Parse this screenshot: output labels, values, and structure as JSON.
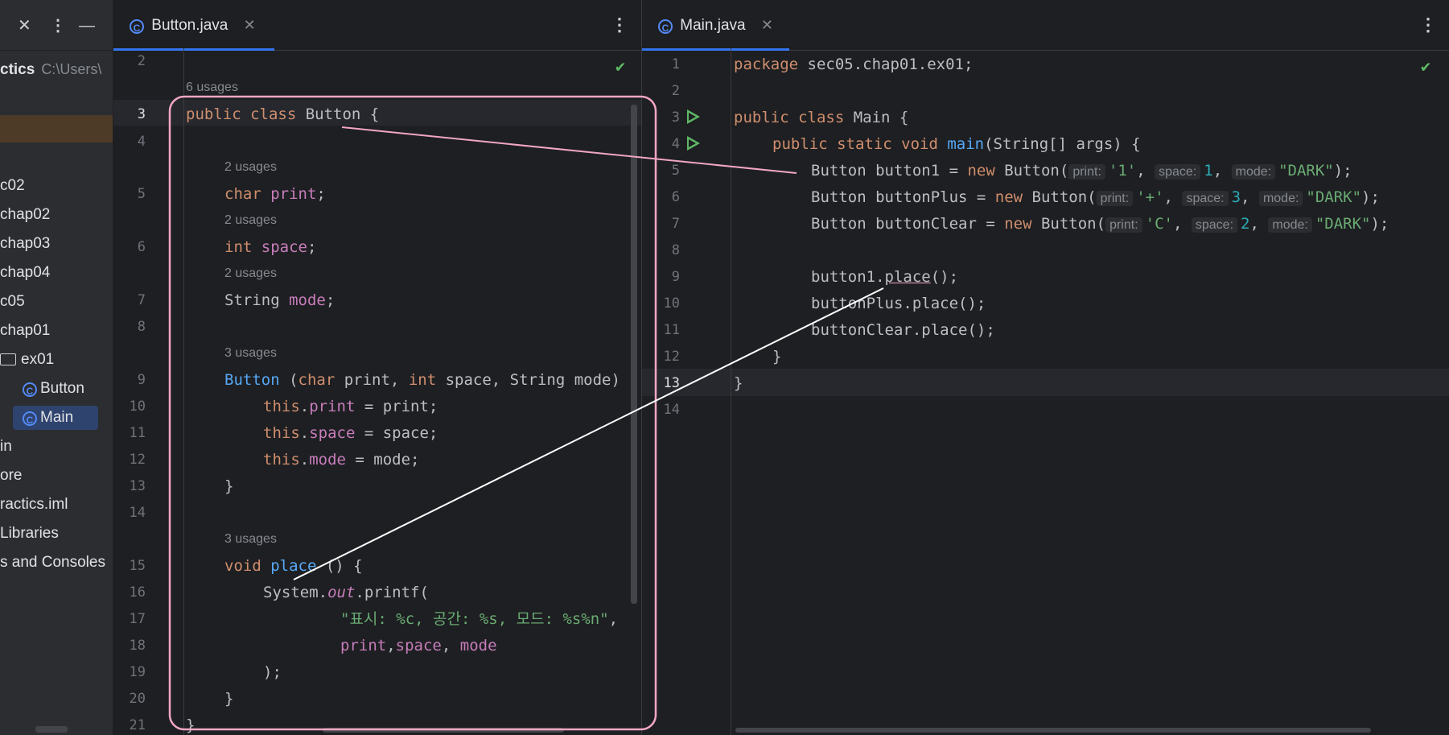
{
  "project": {
    "title": "ctics",
    "path": "C:\\Users\\",
    "tree": [
      "c02",
      "chap02",
      "chap03",
      "chap04",
      "c05",
      "chap01",
      "ex01",
      "Button",
      "Main",
      "in",
      "ore",
      "ractics.iml",
      "Libraries",
      "s and Consoles"
    ]
  },
  "tabs": {
    "left": "Button.java",
    "right": "Main.java"
  },
  "left_editor": {
    "line_numbers": [
      "2",
      "3",
      "4",
      "5",
      "6",
      "7",
      "8",
      "9",
      "10",
      "11",
      "12",
      "13",
      "14",
      "15",
      "16",
      "17",
      "18",
      "19",
      "20",
      "21"
    ],
    "usages": [
      "6 usages",
      "2 usages",
      "2 usages",
      "2 usages",
      "3 usages",
      "3 usages"
    ],
    "code": {
      "l3_kw": "public class ",
      "l3_name": "Button {",
      "l5_kw": "char ",
      "l5_f": "print",
      "l5_end": ";",
      "l6_kw": "int ",
      "l6_f": "space",
      "l6_end": ";",
      "l7_t": "String ",
      "l7_f": "mode",
      "l7_end": ";",
      "l9_fn": "Button ",
      "l9_a": "(",
      "l9_kw1": "char",
      "l9_b": " print, ",
      "l9_kw2": "int",
      "l9_c": " space, String mode)",
      "l10_kw": "this",
      "l10_dot": ".",
      "l10_f": "print",
      "l10_end": " = print;",
      "l11_kw": "this",
      "l11_dot": ".",
      "l11_f": "space",
      "l11_end": " = space;",
      "l12_kw": "this",
      "l12_dot": ".",
      "l12_f": "mode",
      "l12_end": " = mode;",
      "l13": "}",
      "l15_kw": "void ",
      "l15_fn": "place",
      "l15_end": " () {",
      "l16_a": "System.",
      "l16_it": "out",
      "l16_b": ".printf(",
      "l17_str": "\"표시: %c, 공간: %s, 모드: %s%n\"",
      "l17_end": ",",
      "l18_f1": "print",
      "l18_c1": ",",
      "l18_f2": "space",
      "l18_c2": ", ",
      "l18_f3": "mode",
      "l19": ");",
      "l20": "}",
      "l21": "}"
    }
  },
  "right_editor": {
    "line_numbers": [
      "1",
      "2",
      "3",
      "4",
      "5",
      "6",
      "7",
      "8",
      "9",
      "10",
      "11",
      "12",
      "13",
      "14"
    ],
    "code": {
      "l1_kw": "package ",
      "l1_rest": "sec05.chap01.ex01;",
      "l3_kw": "public class ",
      "l3_rest": "Main {",
      "l4_kw": "public static void ",
      "l4_fn": "main",
      "l4_rest": "(String[] args) {",
      "l5_a": "Button button1 = ",
      "l5_kw": "new ",
      "l5_b": "Button(",
      "l5_h1": "print:",
      "l5_v1": "'1'",
      "l5_c1": ",",
      "l5_h2": "space:",
      "l5_v2": "1",
      "l5_c2": ",",
      "l5_h3": "mode:",
      "l5_v3": "\"DARK\"",
      "l5_end": ");",
      "l6_a": "Button buttonPlus = ",
      "l6_kw": "new ",
      "l6_b": "Button(",
      "l6_h1": "print:",
      "l6_v1": "'+'",
      "l6_c1": ",",
      "l6_h2": "space:",
      "l6_v2": "3",
      "l6_c2": ",",
      "l6_h3": "mode:",
      "l6_v3": "\"DARK\"",
      "l6_end": ");",
      "l7_a": "Button buttonClear = ",
      "l7_kw": "new ",
      "l7_b": "Button(",
      "l7_h1": "print:",
      "l7_v1": "'C'",
      "l7_c1": ",",
      "l7_h2": "space:",
      "l7_v2": "2",
      "l7_c2": ",",
      "l7_h3": "mode:",
      "l7_v3": "\"DARK\"",
      "l7_end": ");",
      "l9_a": "button1.",
      "l9_b": "place",
      "l9_c": "();",
      "l10": "buttonPlus.place();",
      "l11": "buttonClear.place();",
      "l12": "}",
      "l13": "}"
    }
  },
  "colors": {
    "keyword": "#cf8e6d",
    "field": "#c77dbb",
    "method": "#56a8f5",
    "string": "#6aab73",
    "number": "#2aacb8",
    "annotation_box": "#f2a7c3",
    "annotation_line": "#ffffff"
  }
}
